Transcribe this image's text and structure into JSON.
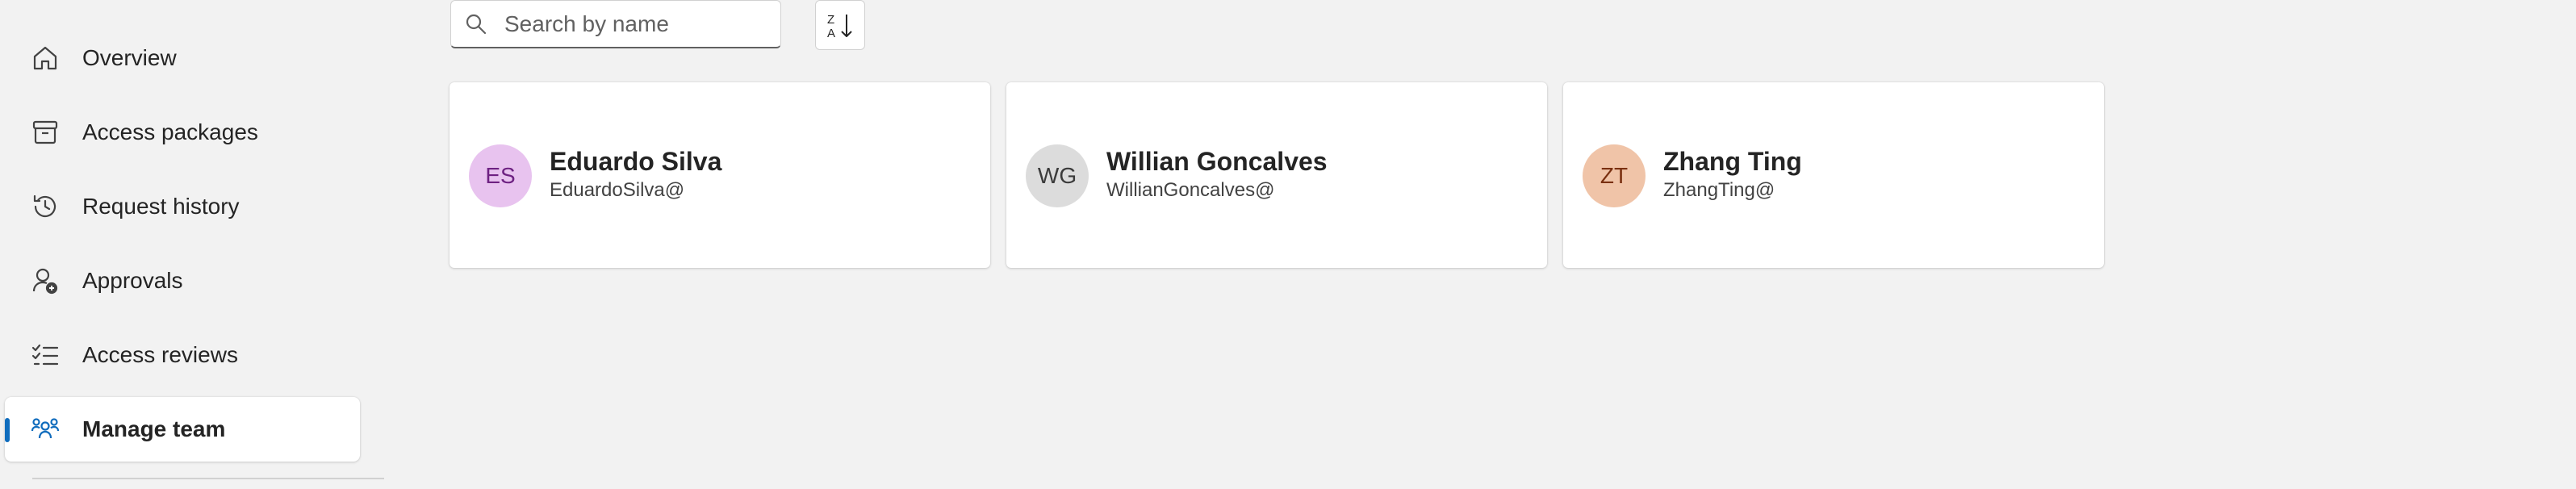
{
  "sidebar": {
    "items": [
      {
        "label": "Overview",
        "icon": "home-icon"
      },
      {
        "label": "Access packages",
        "icon": "archive-icon"
      },
      {
        "label": "Request history",
        "icon": "history-icon"
      },
      {
        "label": "Approvals",
        "icon": "person-approval-icon"
      },
      {
        "label": "Access reviews",
        "icon": "checklist-icon"
      },
      {
        "label": "Manage team",
        "icon": "people-team-icon",
        "active": true
      }
    ],
    "accent_color": "#0f6cbd"
  },
  "toolbar": {
    "search_placeholder": "Search by name",
    "search_value": "",
    "sort_icon": "sort-z-to-a-icon"
  },
  "members": [
    {
      "initials": "ES",
      "name": "Eduardo Silva",
      "email": "EduardoSilva@",
      "avatar_bg": "#e8c3ef",
      "avatar_fg": "#6e2182"
    },
    {
      "initials": "WG",
      "name": "Willian Goncalves",
      "email": "WillianGoncalves@",
      "avatar_bg": "#dcdcdc",
      "avatar_fg": "#3b3b3b"
    },
    {
      "initials": "ZT",
      "name": "Zhang Ting",
      "email": "ZhangTing@",
      "avatar_bg": "#f0c4a8",
      "avatar_fg": "#7a3010"
    }
  ]
}
